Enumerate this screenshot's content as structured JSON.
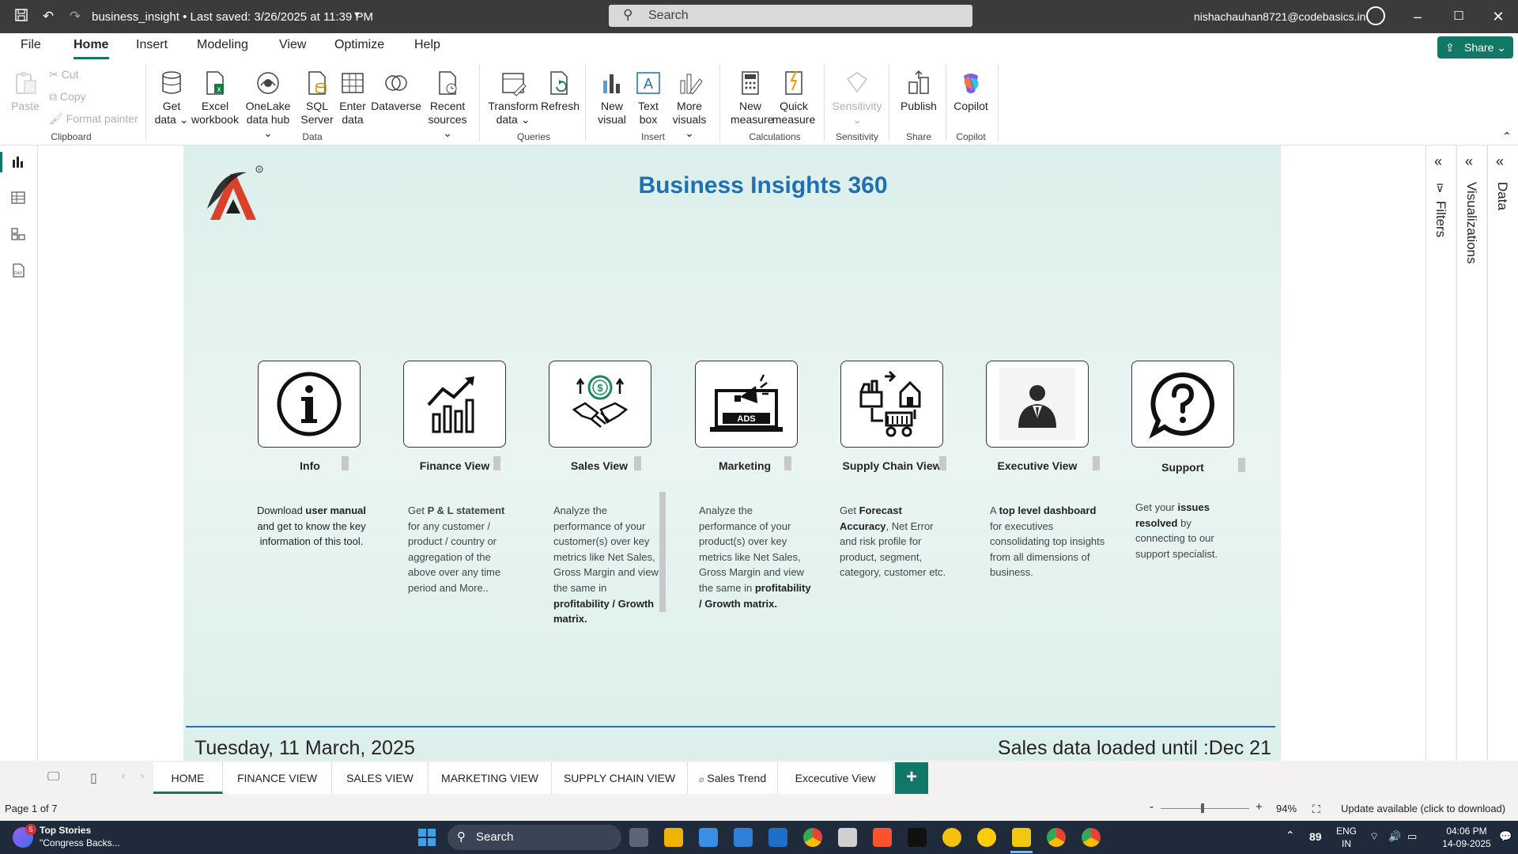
{
  "titlebar": {
    "title": "business_insight • Last saved: 3/26/2025 at 11:39 PM",
    "search_placeholder": "Search",
    "user": "nishachauhan8721@codebasics.in"
  },
  "menu": {
    "items": [
      "File",
      "Home",
      "Insert",
      "Modeling",
      "View",
      "Optimize",
      "Help"
    ],
    "share": "Share"
  },
  "ribbon": {
    "clipboard": {
      "paste": "Paste",
      "cut": "Cut",
      "copy": "Copy",
      "format_painter": "Format painter",
      "label": "Clipboard"
    },
    "data": {
      "get_data": [
        "Get",
        "data"
      ],
      "excel": [
        "Excel",
        "workbook"
      ],
      "onelake": [
        "OneLake",
        "data hub"
      ],
      "sql": [
        "SQL",
        "Server"
      ],
      "enter": [
        "Enter",
        "data"
      ],
      "dataverse": "Dataverse",
      "recent": [
        "Recent",
        "sources"
      ],
      "label": "Data"
    },
    "queries": {
      "transform": [
        "Transform",
        "data"
      ],
      "refresh": "Refresh",
      "label": "Queries"
    },
    "insert": {
      "new_visual": [
        "New",
        "visual"
      ],
      "text_box": [
        "Text",
        "box"
      ],
      "more_visuals": [
        "More",
        "visuals"
      ],
      "label": "Insert"
    },
    "calculations": {
      "new_measure": [
        "New",
        "measure"
      ],
      "quick_measure": [
        "Quick",
        "measure"
      ],
      "label": "Calculations"
    },
    "sensitivity": {
      "btn": "Sensitivity",
      "label": "Sensitivity"
    },
    "share": {
      "publish": "Publish",
      "label": "Share"
    },
    "copilot": {
      "btn": "Copilot",
      "label": "Copilot"
    }
  },
  "report": {
    "title": "Business Insights 360",
    "cards": [
      {
        "label": "Info"
      },
      {
        "label": "Finance View"
      },
      {
        "label": "Sales View"
      },
      {
        "label": "Marketing"
      },
      {
        "label": "Supply Chain View"
      },
      {
        "label": "Executive View"
      },
      {
        "label": "Support"
      }
    ],
    "descriptions": {
      "info": [
        "Download ",
        "user manual",
        " and get to know the key information of this tool."
      ],
      "finance": [
        "Get  ",
        "P & L statement",
        " for any customer / product / country or aggregation of the above over any time period and More.."
      ],
      "sales": [
        "Analyze the performance of your customer(s) over key metrics like Net Sales, Gross Margin and view the same in ",
        "profitability / Growth matrix."
      ],
      "marketing": [
        "Analyze the performance of your product(s) over key metrics like Net Sales, Gross Margin and view the same in ",
        "profitability / Growth matrix."
      ],
      "supply": [
        "Get ",
        "Forecast Accuracy",
        ", Net Error and risk profile for product, segment, category, customer etc."
      ],
      "executive": [
        "A ",
        "top level dashboard",
        " for executives consolidating top insights from all dimensions of business."
      ],
      "support": [
        "Get your ",
        "issues resolved",
        " by connecting to our support specialist."
      ]
    },
    "ads_label": "ADS",
    "footer_date": "Tuesday, 11 March, 2025",
    "footer_loaded": "Sales data loaded until :Dec 21"
  },
  "panes": {
    "filters": "Filters",
    "visualizations": "Visualizations",
    "data": "Data"
  },
  "page_tabs": [
    "HOME",
    "FINANCE VIEW",
    "SALES VIEW",
    "MARKETING VIEW",
    "SUPPLY CHAIN VIEW",
    "Sales Trend",
    "Excecutive View"
  ],
  "status": {
    "page": "Page 1 of 7",
    "zoom": "94%",
    "update": "Update available (click to download)"
  },
  "taskbar": {
    "news_title": "Top Stories",
    "news_sub": "\"Congress Backs...",
    "search": "Search",
    "temp": "89",
    "lang1": "ENG",
    "lang2": "IN",
    "time": "04:06 PM",
    "date": "14-09-2025",
    "badge": "5"
  },
  "colors": {
    "accent": "#117865",
    "title_blue": "#1f6fb4",
    "logo_red": "#d9412b"
  }
}
